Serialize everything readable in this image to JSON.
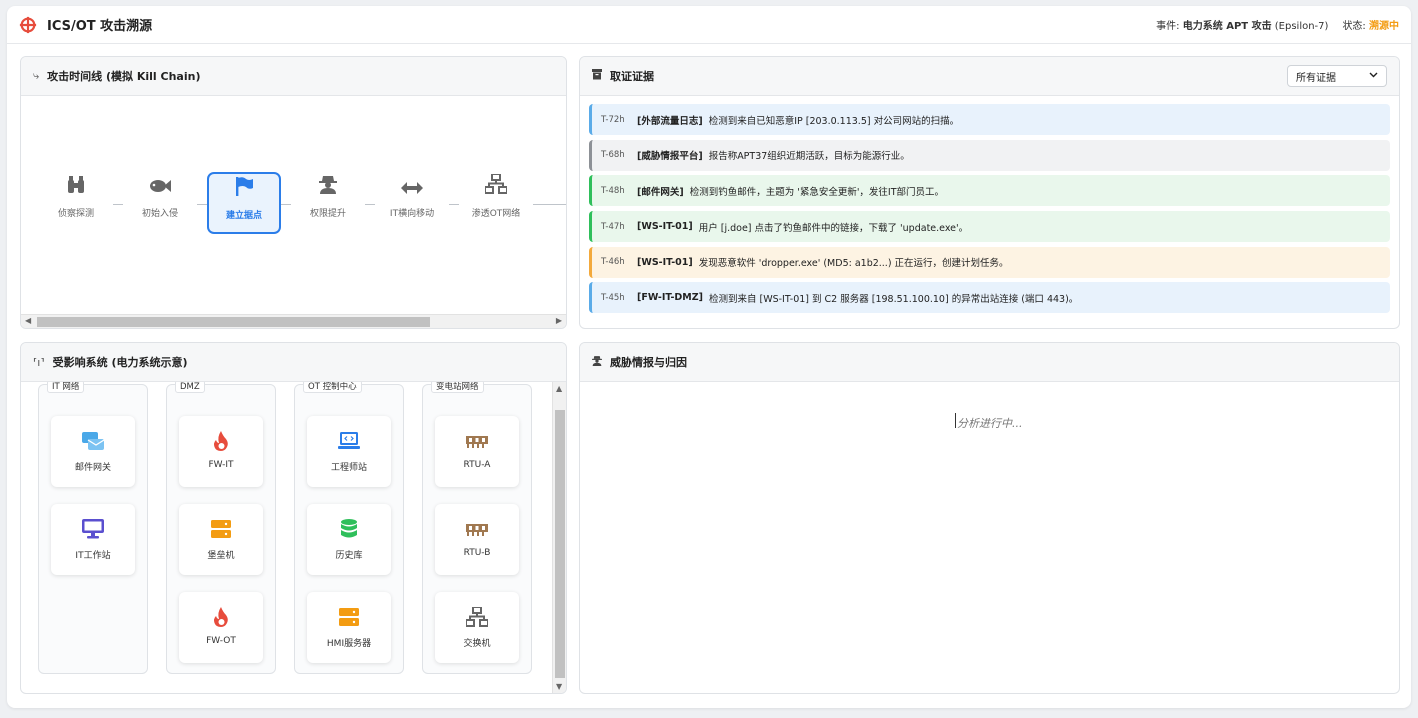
{
  "header": {
    "title": "ICS/OT 攻击溯源",
    "incident_label": "事件:",
    "incident_value": "电力系统 APT 攻击",
    "incident_suffix": "(Epsilon-7)",
    "status_label": "状态:",
    "status_value": "溯源中",
    "logo_icon": "crosshair-icon",
    "accent": "#e74c3c"
  },
  "timeline": {
    "title": "攻击时间线 (模拟 Kill Chain)",
    "icon": "route-icon",
    "steps": [
      {
        "label": "侦察探测",
        "icon": "binoculars-icon"
      },
      {
        "label": "初始入侵",
        "icon": "fish-icon"
      },
      {
        "label": "建立据点",
        "icon": "flag-icon"
      },
      {
        "label": "权限提升",
        "icon": "user-secret-icon"
      },
      {
        "label": "IT横向移动",
        "icon": "arrows-lr-icon"
      },
      {
        "label": "渗透OT网络",
        "icon": "network-icon"
      }
    ],
    "active_index": 2
  },
  "evidence": {
    "title": "取证证据",
    "icon": "archive-icon",
    "filter": "所有证据",
    "items": [
      {
        "time": "T-72h",
        "source": "[外部流量日志]",
        "text": "检测到来自已知恶意IP [203.0.113.5] 对公司网站的扫描。",
        "color": "blue"
      },
      {
        "time": "T-68h",
        "source": "[威胁情报平台]",
        "text": "报告称APT37组织近期活跃，目标为能源行业。",
        "color": "gray"
      },
      {
        "time": "T-48h",
        "source": "[邮件网关]",
        "text": "检测到钓鱼邮件，主题为 '紧急安全更新'，发往IT部门员工。",
        "color": "green"
      },
      {
        "time": "T-47h",
        "source": "[WS-IT-01]",
        "text": "用户 [j.doe] 点击了钓鱼邮件中的链接，下载了 'update.exe'。",
        "color": "green"
      },
      {
        "time": "T-46h",
        "source": "[WS-IT-01]",
        "text": "发现恶意软件 'dropper.exe' (MD5: a1b2...) 正在运行，创建计划任务。",
        "color": "orange"
      },
      {
        "time": "T-45h",
        "source": "[FW-IT-DMZ]",
        "text": "检测到来自 [WS-IT-01] 到 C2 服务器 [198.51.100.10] 的异常出站连接 (端口 443)。",
        "color": "blue"
      }
    ]
  },
  "systems": {
    "title": "受影响系统 (电力系统示意)",
    "icon": "antenna-icon",
    "zones": [
      {
        "label": "IT 网络",
        "nodes": [
          {
            "label": "邮件网关",
            "icon": "mail-gateway-icon",
            "color": "#4aa8e8"
          },
          {
            "label": "IT工作站",
            "icon": "desktop-icon",
            "color": "#5a4fcf"
          }
        ]
      },
      {
        "label": "DMZ",
        "nodes": [
          {
            "label": "FW-IT",
            "icon": "fire-icon",
            "color": "#e74c3c"
          },
          {
            "label": "堡垒机",
            "icon": "server-icon",
            "color": "#f39c12"
          },
          {
            "label": "FW-OT",
            "icon": "fire-icon",
            "color": "#e74c3c"
          }
        ]
      },
      {
        "label": "OT 控制中心",
        "nodes": [
          {
            "label": "工程师站",
            "icon": "laptop-code-icon",
            "color": "#2b7de9"
          },
          {
            "label": "历史库",
            "icon": "database-icon",
            "color": "#2fbf5b"
          },
          {
            "label": "HMI服务器",
            "icon": "server-icon",
            "color": "#f39c12"
          }
        ]
      },
      {
        "label": "变电站网络",
        "nodes": [
          {
            "label": "RTU-A",
            "icon": "memory-icon",
            "color": "#a07850"
          },
          {
            "label": "RTU-B",
            "icon": "memory-icon",
            "color": "#a07850"
          },
          {
            "label": "交换机",
            "icon": "network-icon",
            "color": "#666666"
          }
        ]
      }
    ]
  },
  "intel": {
    "title": "威胁情报与归因",
    "icon": "user-secret-icon",
    "status": "分析进行中..."
  }
}
